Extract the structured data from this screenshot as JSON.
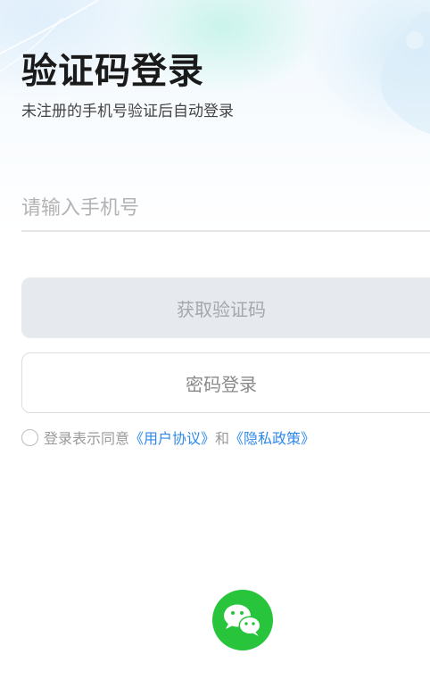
{
  "header": {
    "title": "验证码登录",
    "subtitle": "未注册的手机号验证后自动登录"
  },
  "phone_input": {
    "placeholder": "请输入手机号",
    "value": ""
  },
  "buttons": {
    "get_code": "获取验证码",
    "password_login": "密码登录"
  },
  "agreement": {
    "prefix": "登录表示同意",
    "user_agreement": "《用户协议》",
    "conjunction": "和",
    "privacy_policy": "《隐私政策》",
    "checked": false
  },
  "social_login": {
    "icon": "wechat-icon",
    "color": "#27c43c"
  },
  "colors": {
    "link": "#2f88e8",
    "disabled_button_bg": "#e6e9ed",
    "wechat_green": "#27c43c"
  }
}
